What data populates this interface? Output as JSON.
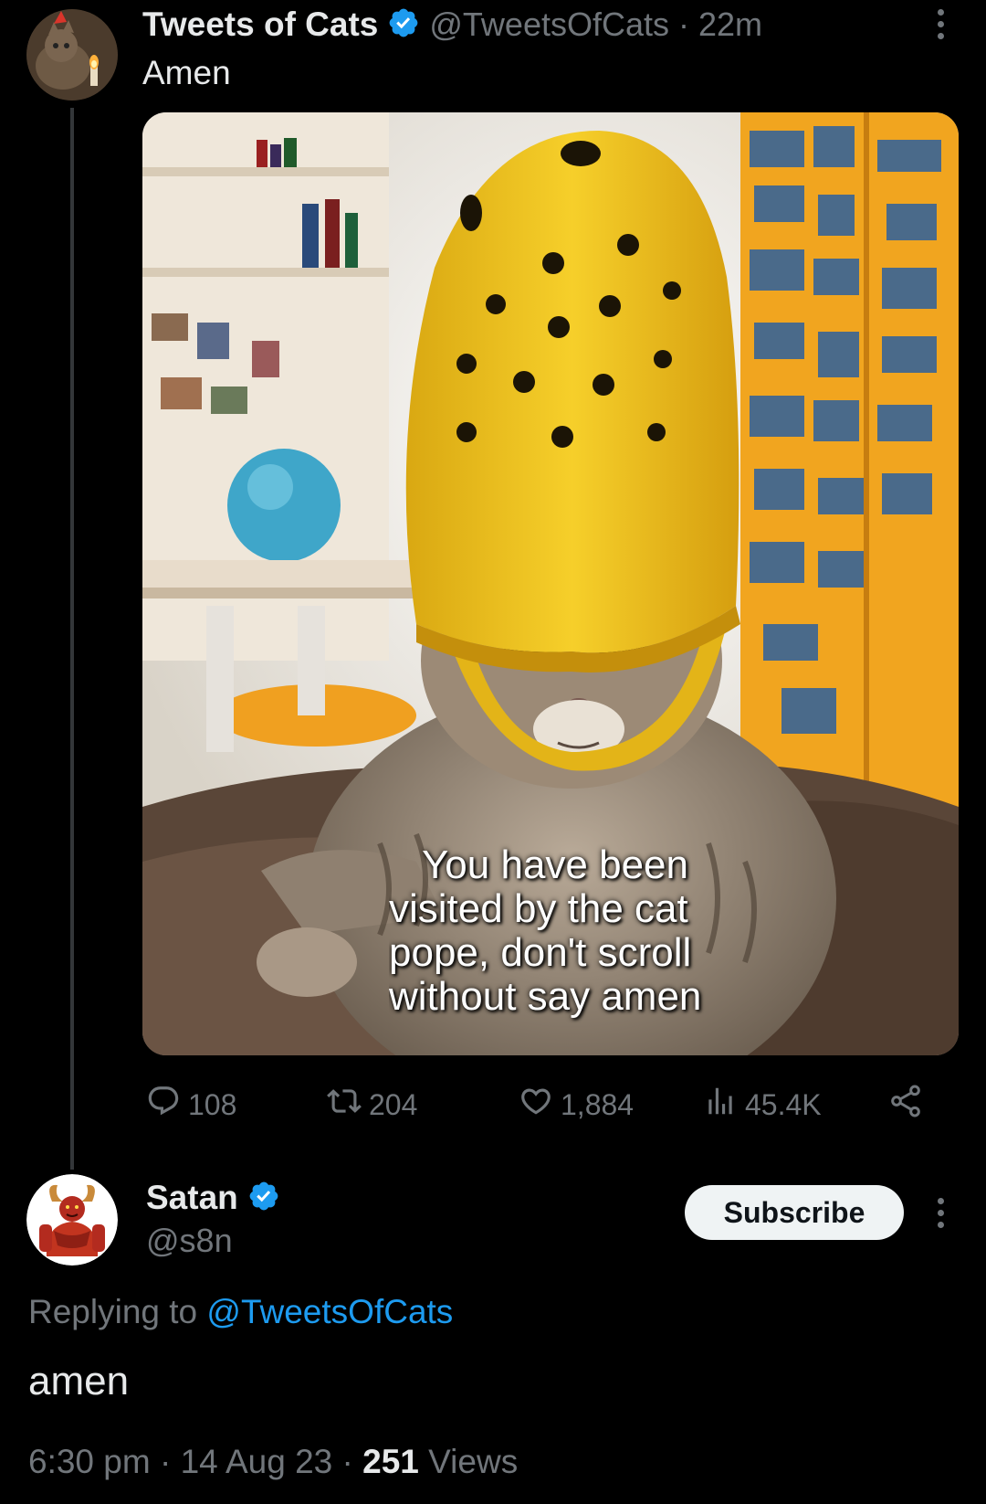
{
  "tweet": {
    "author_name": "Tweets of Cats",
    "handle": "@TweetsOfCats",
    "separator": "·",
    "time": "22m",
    "text": "Amen",
    "media_caption_lines": [
      "You have been",
      "visited by the cat",
      "pope, don't scroll",
      "without say amen"
    ],
    "stats": {
      "replies": "108",
      "retweets": "204",
      "likes": "1,884",
      "views": "45.4K"
    }
  },
  "reply": {
    "author_name": "Satan",
    "handle": "@s8n",
    "subscribe_label": "Subscribe",
    "replying_prefix": "Replying to",
    "replying_handle": "@TweetsOfCats",
    "text": "amen",
    "time": "6:30 pm",
    "date": "14 Aug 23",
    "views_count": "251",
    "views_label": "Views",
    "sep": "·"
  },
  "colors": {
    "background": "#000000",
    "accent": "#1d9bf0",
    "muted": "#71767b",
    "text": "#e7e9ea",
    "crocs_yellow": "#f2c51b"
  },
  "icons": [
    "verified-badge-icon",
    "more-icon",
    "reply-icon",
    "retweet-icon",
    "like-icon",
    "views-icon",
    "share-icon"
  ]
}
